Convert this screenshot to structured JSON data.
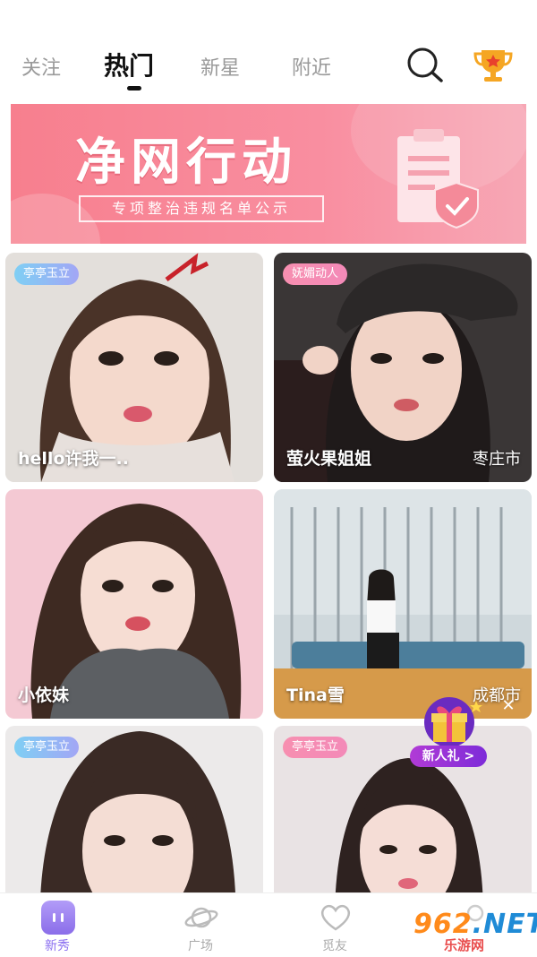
{
  "tabs": [
    {
      "label": "关注"
    },
    {
      "label": "热门"
    },
    {
      "label": "新星"
    },
    {
      "label": "附近"
    }
  ],
  "banner": {
    "title": "净网行动",
    "subtitle": "专项整治违规名单公示"
  },
  "cards": [
    {
      "tag": "亭亭玉立",
      "name": "hello许我一..",
      "city": ""
    },
    {
      "tag": "妩媚动人",
      "name": "萤火果姐姐",
      "city": "枣庄市"
    },
    {
      "tag": "",
      "name": "小依妹",
      "city": ""
    },
    {
      "tag": "",
      "name": "Tina雪",
      "city": "成都市"
    },
    {
      "tag": "亭亭玉立",
      "name": "",
      "city": ""
    },
    {
      "tag": "亭亭玉立",
      "name": "",
      "city": ""
    }
  ],
  "gift": {
    "label": "新人礼 >"
  },
  "nav": [
    {
      "label": "新秀",
      "icon": "home-icon"
    },
    {
      "label": "广场",
      "icon": "planet-icon"
    },
    {
      "label": "觅友",
      "icon": "heart-icon"
    },
    {
      "label": "",
      "icon": "profile-icon"
    }
  ],
  "watermark": {
    "brand_num": "962",
    "brand_tld": ".NET",
    "site": "乐游网"
  },
  "colors": {
    "accent": "#8b6ff0",
    "banner": "#f77f8e",
    "tag_blue": "#7fcff4",
    "tag_pink": "#f78fb0"
  }
}
